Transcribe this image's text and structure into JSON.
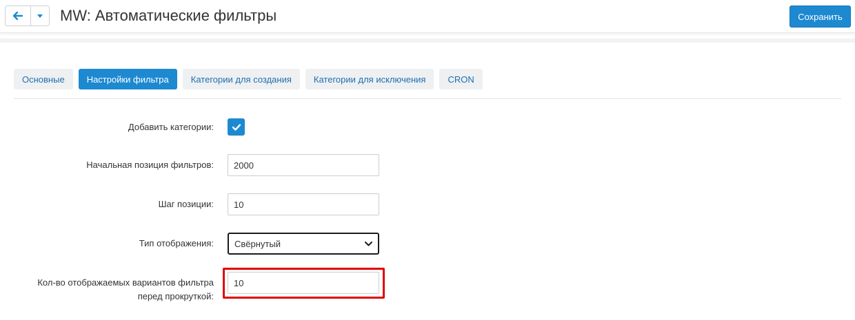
{
  "header": {
    "title": "MW: Автоматические фильтры",
    "save_label": "Сохранить"
  },
  "tabs": [
    {
      "label": "Основные",
      "active": false
    },
    {
      "label": "Настройки фильтра",
      "active": true
    },
    {
      "label": "Категории для создания",
      "active": false
    },
    {
      "label": "Категории для исключения",
      "active": false
    },
    {
      "label": "CRON",
      "active": false
    }
  ],
  "form": {
    "add_categories": {
      "label": "Добавить категории:",
      "checked": true
    },
    "start_position": {
      "label": "Начальная позиция фильтров:",
      "value": "2000"
    },
    "position_step": {
      "label": "Шаг позиции:",
      "value": "10"
    },
    "display_type": {
      "label": "Тип отображения:",
      "value": "Свёрнутый"
    },
    "visible_variants": {
      "label_line1": "Кол-во отображаемых вариантов фильтра",
      "label_line2": "перед прокруткой:",
      "value": "10"
    }
  },
  "colors": {
    "accent": "#1d89d0",
    "highlight": "#e00000"
  },
  "icons": {
    "back": "arrow-left-icon",
    "dropdown": "caret-down-icon",
    "check": "check-icon",
    "select_chevron": "chevron-down-icon"
  }
}
